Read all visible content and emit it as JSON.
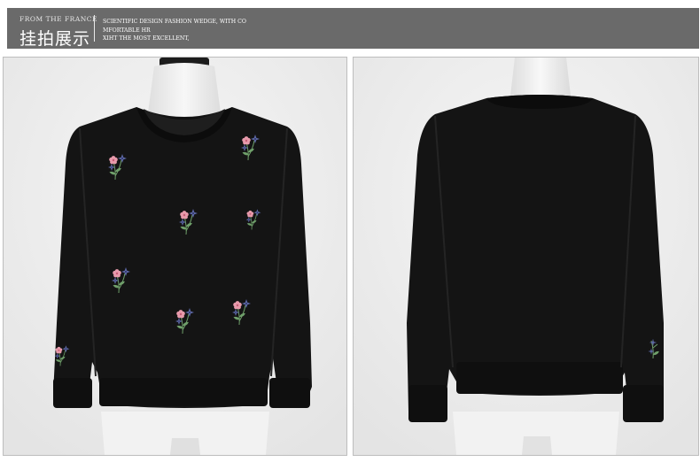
{
  "header": {
    "from_text": "FROM   THE FRANCE",
    "title": "挂拍展示",
    "slogan_lines": [
      "SCIENTIFIC DESIGN FASHION WEDGE, WITH CO",
      "MFORTABLE HR",
      "XIHT THE MOST EXCELLENT,"
    ]
  },
  "colors": {
    "header_bg": "#6a6a6a",
    "panel_bg": "#eeeeee",
    "sweater": "#141414",
    "embroidery_pink": "#e79aab",
    "embroidery_blue": "#5d68a6",
    "embroidery_green": "#6f9f6a"
  },
  "photos": [
    {
      "view": "front",
      "icon": "embroidered-sweatshirt-front-photo"
    },
    {
      "view": "back",
      "icon": "sweatshirt-back-photo"
    }
  ]
}
